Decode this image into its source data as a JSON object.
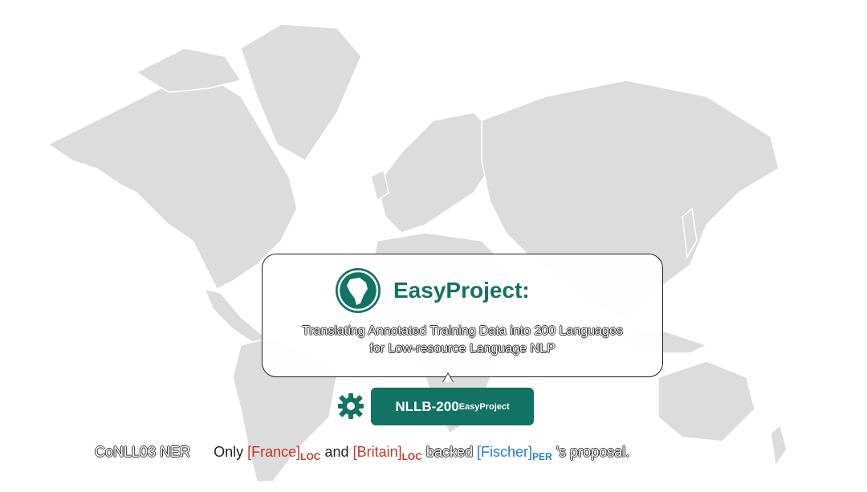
{
  "project": {
    "title": "EasyProject:",
    "subtitle_line1": "Translating Annotated Training Data into 200 Languages",
    "subtitle_line2": "for Low-resource Language NLP"
  },
  "model": {
    "name": "NLLB-200",
    "suffix": "EasyProject"
  },
  "example": {
    "dataset": "CoNLL03 NER",
    "t1": "Only",
    "ent1": "[France]",
    "tag1": "LOC",
    "t2": "and",
    "ent2": "[Britain]",
    "tag2": "LOC",
    "t3": "backed",
    "ent3": "[Fischer]",
    "tag3": "PER",
    "t4": "'s proposal."
  },
  "colors": {
    "brand": "#127264",
    "loc": "#c0392b",
    "per": "#1f7fbf",
    "land": "#dcdcdc"
  },
  "icons": [
    "globe-africa-icon",
    "gear-icon"
  ]
}
